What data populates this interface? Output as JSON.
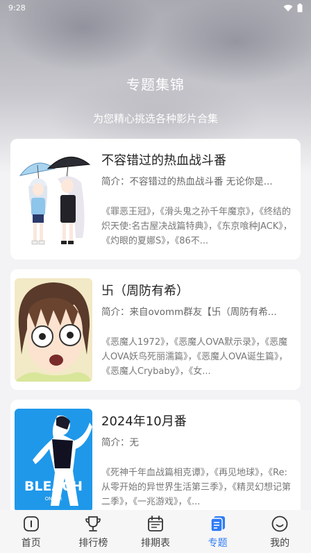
{
  "status_bar": {
    "time": "9:28"
  },
  "header": {
    "title": "专题集锦",
    "subtitle": "为您精心挑选各种影片合集"
  },
  "topics": [
    {
      "title": "不容错过的热血战斗番",
      "intro": "简介：不容错过的热血战斗番 无论你是...",
      "works": "《罪恶王冠》，《滑头鬼之孙千年魔京》，《终结的炽天使:名古屋决战篇特典》，《东京喰种JACK》，《灼眼的夏娜S》，《86不..."
    },
    {
      "title": "卐（周防有希）",
      "intro": "简介：来自ovomm群友【卐（周防有希...",
      "works": "《恶魔人1972》，《恶魔人OVA默示录》，《恶魔人OVA妖鸟死丽濡篇》，《恶魔人OVA诞生篇》，《恶魔人Crybaby》，《女..."
    },
    {
      "title": "2024年10月番",
      "intro": "简介：无",
      "works": "《死神千年血战篇相克谭》，《再见地球》，《Re:从零开始的异世界生活第三季》，《精灵幻想记第二季》，《一兆游戏》，《..."
    }
  ],
  "poster_text": {
    "bleach_logo": "BLEACH",
    "bleach_sub": "ON AIR"
  },
  "bottom_nav": {
    "items": [
      {
        "label": "首页",
        "icon": "home-icon"
      },
      {
        "label": "排行榜",
        "icon": "trophy-icon"
      },
      {
        "label": "排期表",
        "icon": "calendar-icon"
      },
      {
        "label": "专题",
        "icon": "topic-icon",
        "active": true
      },
      {
        "label": "我的",
        "icon": "profile-icon"
      }
    ],
    "active_color": "#2f7cf6"
  }
}
